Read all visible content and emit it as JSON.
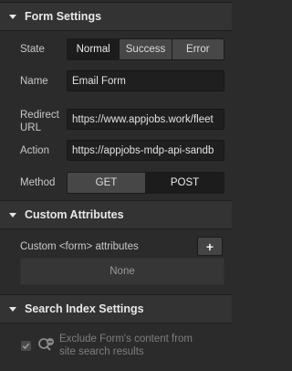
{
  "form_settings": {
    "title": "Form Settings",
    "state_label": "State",
    "state_options": [
      "Normal",
      "Success",
      "Error"
    ],
    "state_selected": "Normal",
    "name_label": "Name",
    "name_value": "Email Form",
    "redirect_label_line1": "Redirect",
    "redirect_label_line2": "URL",
    "redirect_value": "https://www.appjobs.work/fleet",
    "action_label": "Action",
    "action_value": "https://appjobs-mdp-api-sandb",
    "method_label": "Method",
    "method_options": [
      "GET",
      "POST"
    ],
    "method_selected": "GET"
  },
  "custom_attributes": {
    "title": "Custom Attributes",
    "label": "Custom <form> attributes",
    "add_label": "+",
    "empty_text": "None"
  },
  "search_index": {
    "title": "Search Index Settings",
    "exclude_line1": "Exclude Form's content from",
    "exclude_line2": "site search results",
    "exclude_checked": true
  },
  "icons": {
    "section_caret": "caret-down-icon",
    "add": "plus-icon",
    "search_exclude": "search-minus-icon"
  }
}
